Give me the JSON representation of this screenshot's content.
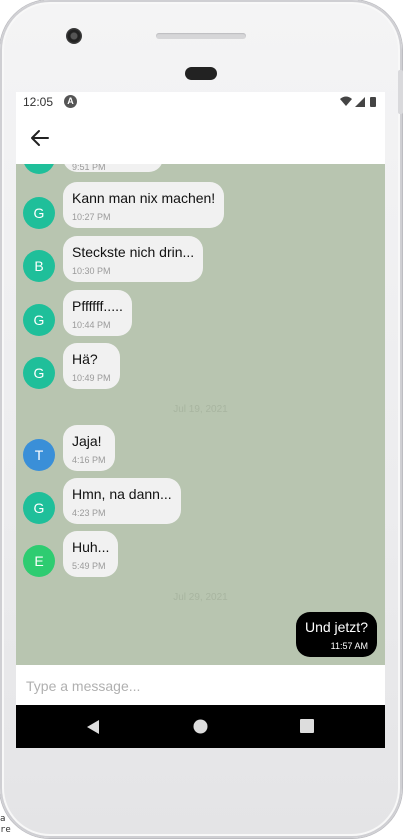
{
  "status_bar": {
    "time": "12:05",
    "notification_letter": "A"
  },
  "composer": {
    "placeholder": "Type a message..."
  },
  "messages": [
    {
      "sender_initial": "",
      "text": "",
      "time": "9:51 PM"
    },
    {
      "sender_initial": "G",
      "text": "Kann man nix machen!",
      "time": "10:27 PM"
    },
    {
      "sender_initial": "B",
      "text": "Steckste nich drin...",
      "time": "10:30 PM"
    },
    {
      "sender_initial": "G",
      "text": "Pffffff.....",
      "time": "10:44 PM"
    },
    {
      "sender_initial": "G",
      "text": "Hä?",
      "time": "10:49 PM"
    },
    {
      "sender_initial": "T",
      "text": "Jaja!",
      "time": "4:16 PM"
    },
    {
      "sender_initial": "G",
      "text": "Hmn, na dann...",
      "time": "4:23 PM"
    },
    {
      "sender_initial": "E",
      "text": "Huh...",
      "time": "5:49 PM"
    }
  ],
  "day_separators": [
    "Jul 19, 2021",
    "Jul 29, 2021"
  ],
  "outgoing": {
    "text": "Und jetzt?",
    "time": "11:57 AM"
  },
  "colors": {
    "chat_background": "#b8c5b0",
    "avatar_G": "#1fbf9a",
    "avatar_B": "#1fbf9a",
    "avatar_T": "#3a8fd8",
    "avatar_E": "#2ecc71",
    "outgoing_bubble": "#000000"
  },
  "edge_text": [
    "a",
    "re"
  ]
}
